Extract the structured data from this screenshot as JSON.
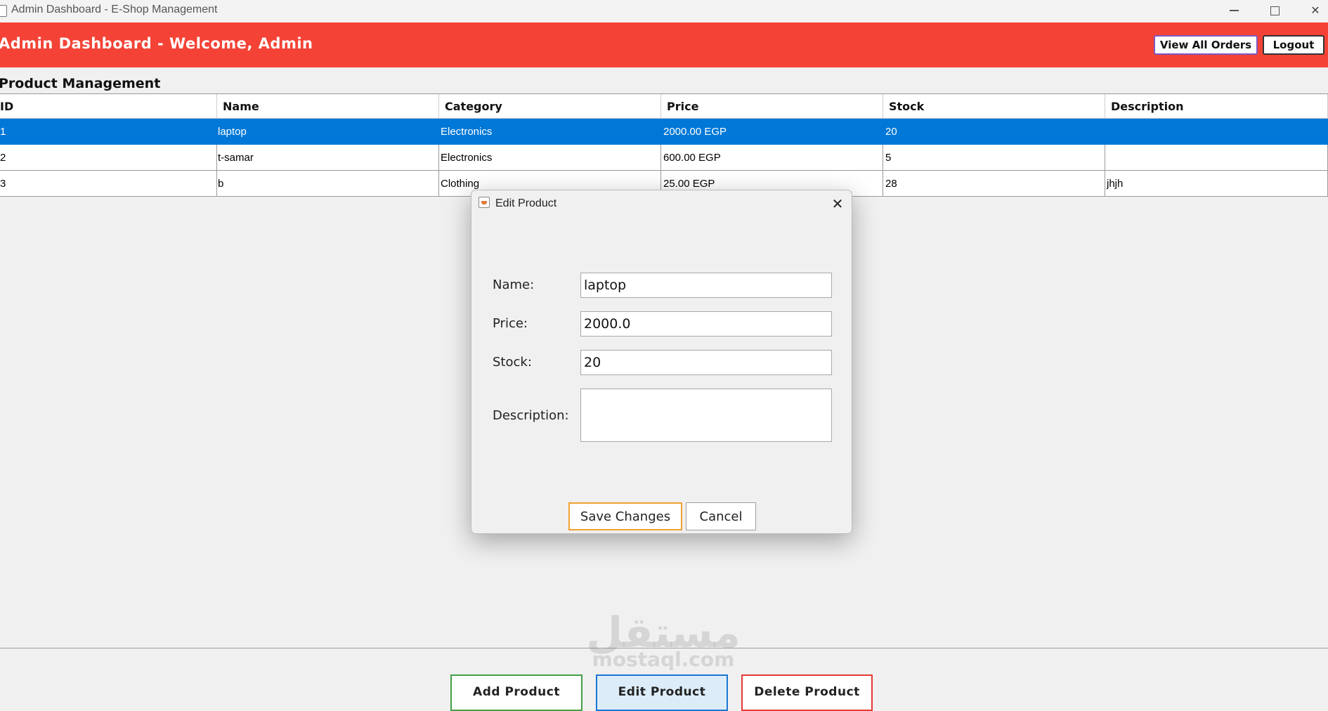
{
  "window": {
    "title": "Admin Dashboard - E-Shop Management"
  },
  "header": {
    "title": "Admin Dashboard - Welcome, Admin",
    "view_orders_label": "View All Orders",
    "logout_label": "Logout",
    "color": "#f44336"
  },
  "section": {
    "title": "Product Management"
  },
  "table": {
    "columns": [
      "ID",
      "Name",
      "Category",
      "Price",
      "Stock",
      "Description"
    ],
    "rows": [
      [
        "1",
        "laptop",
        "Electronics",
        "2000.00 EGP",
        "20",
        ""
      ],
      [
        "2",
        "t-samar",
        "Electronics",
        "600.00 EGP",
        "5",
        ""
      ],
      [
        "3",
        "b",
        "Clothing",
        "25.00 EGP",
        "28",
        "jhjh"
      ]
    ],
    "selected_row": 0,
    "selection_color": "#0078d7"
  },
  "dialog": {
    "title": "Edit Product",
    "fields": {
      "name_label": "Name:",
      "name_value": "laptop",
      "price_label": "Price:",
      "price_value": "2000.0",
      "stock_label": "Stock:",
      "stock_value": "20",
      "description_label": "Description:",
      "description_value": ""
    },
    "save_label": "Save Changes",
    "cancel_label": "Cancel"
  },
  "actions": {
    "add_label": "Add Product",
    "edit_label": "Edit Product",
    "delete_label": "Delete Product"
  },
  "watermark": {
    "arabic": "مستقل",
    "latin": "mostaql.com"
  },
  "icons": {
    "app": "java-app-icon",
    "minimize": "minimize-icon",
    "maximize": "maximize-icon",
    "close": "close-icon"
  }
}
